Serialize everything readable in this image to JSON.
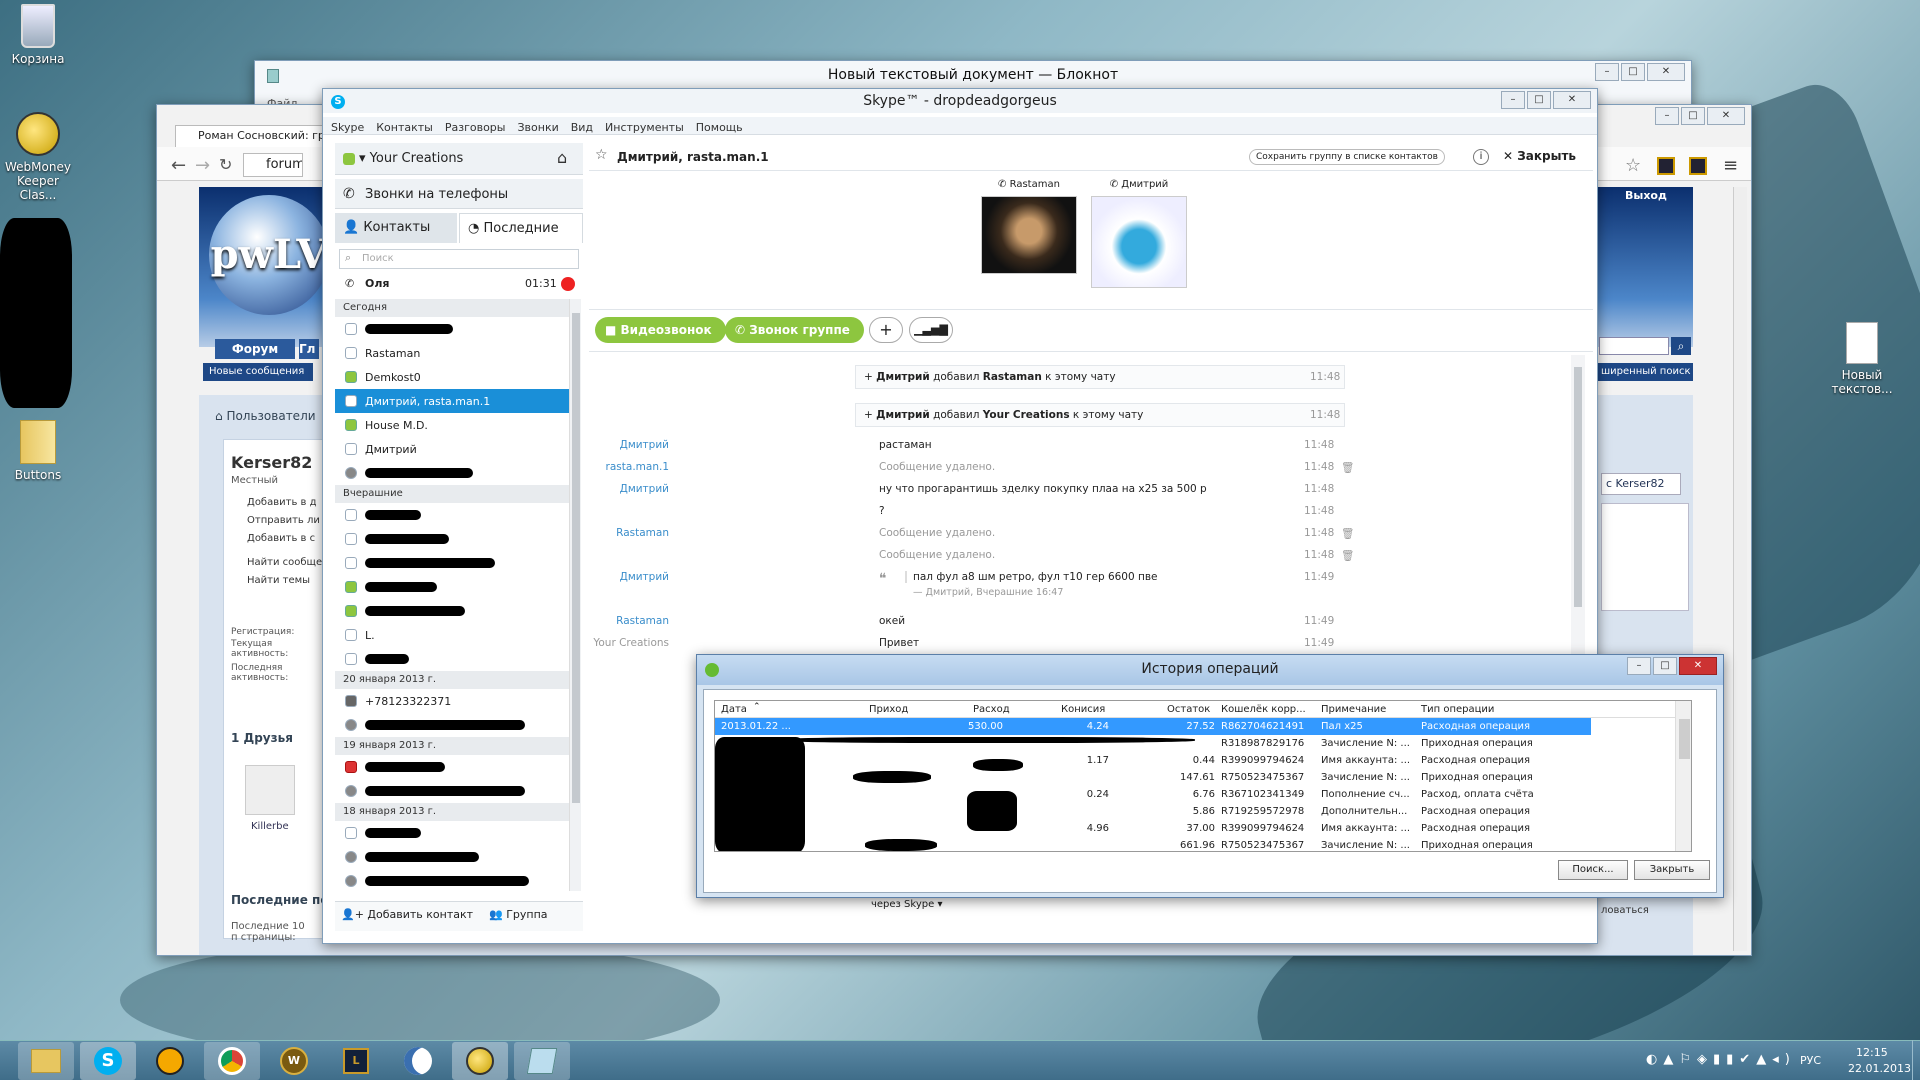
{
  "desktop": {
    "icons": [
      {
        "label": "Корзина"
      },
      {
        "label": "WebMoney Keeper Clas..."
      },
      {
        "label": "Buttons"
      },
      {
        "label": "Новый текстов..."
      }
    ]
  },
  "notepad": {
    "title": "Новый текстовый документ — Блокнот",
    "menu_file": "Файл"
  },
  "browser": {
    "tab_title": "Роман Сосновский: гр",
    "url": "forum",
    "logo": "pwLV",
    "nav_forum": "Форум",
    "nav_other": "Гл",
    "new_messages": "Новые сообщения",
    "exit": "Выход",
    "ext_search": "ширенный поиск",
    "breadcrumb": "Пользователи",
    "username": "Kerser82",
    "user_role": "Местный",
    "actions": [
      "Добавить в д",
      "Отправить ли",
      "Добавить в с",
      "Найти сообще",
      "Найти темы"
    ],
    "stats_labels": [
      "Регистрация:",
      "Текущая активность:",
      "Последняя активность:"
    ],
    "friends": "1 Друзья",
    "friend_name": "Killerbe",
    "recent_visits": "Последние по",
    "recent_sub": "Последние 10 п страницы:",
    "right_tab": "с Kerser82",
    "right_link": "ловаться"
  },
  "skype": {
    "title": "Skype™ - dropdeadgorgeus",
    "menu": [
      "Skype",
      "Контакты",
      "Разговоры",
      "Звонки",
      "Вид",
      "Инструменты",
      "Помощь"
    ],
    "profile": "Your Creations",
    "phone_calls": "Звонки на телефоны",
    "tab_contacts": "Контакты",
    "tab_recent": "Последние",
    "search_placeholder": "Поиск",
    "active_call": {
      "name": "Оля",
      "time": "01:31"
    },
    "sections": {
      "today": "Сегодня",
      "yesterday": "Вчерашние",
      "jan20": "20 января 2013 г.",
      "jan19": "19 января 2013 г.",
      "jan18": "18 января 2013 г."
    },
    "contacts_today": [
      "Rastaman",
      "Demkost0",
      "Дмитрий, rasta.man.1",
      "House M.D.",
      "Дмитрий"
    ],
    "contact_L": "L.",
    "contact_phone": "+78123322371",
    "add_contact": "Добавить контакт",
    "group": "Группа",
    "chat_title": "Дмитрий, rasta.man.1",
    "save_group": "Сохранить группу в списке контактов",
    "close": "Закрыть",
    "participants": [
      "Rastaman",
      "Дмитрий"
    ],
    "video_call": "Видеозвонок",
    "group_call": "Звонок группе",
    "via": "через Skype",
    "system_msgs": [
      {
        "actor": "Дмитрий",
        "mid": "добавил",
        "target": "Rastaman",
        "rest": "к этому чату",
        "time": "11:48"
      },
      {
        "actor": "Дмитрий",
        "mid": "добавил",
        "target": "Your Creations",
        "rest": "к этому чату",
        "time": "11:48"
      }
    ],
    "messages": [
      {
        "who": "Дмитрий",
        "text": "растаман",
        "time": "11:48"
      },
      {
        "who": "rasta.man.1",
        "text": "Сообщение удалено.",
        "time": "11:48"
      },
      {
        "who": "Дмитрий",
        "text": "ну что прогарантишь зделку покупку плаа на х25 за 500 р",
        "time": "11:48"
      },
      {
        "who": "",
        "text": "?",
        "time": "11:48"
      },
      {
        "who": "Rastaman",
        "text": "Сообщение удалено.",
        "time": "11:48"
      },
      {
        "who": "",
        "text": "Сообщение удалено.",
        "time": "11:48"
      },
      {
        "who": "Дмитрий",
        "text": "пал фул а8 шм ретро, фул т10 гер 6600 пве",
        "time": "11:49"
      },
      {
        "who": "Rastaman",
        "text": "окей",
        "time": "11:49"
      },
      {
        "who": "Your Creations",
        "text": "Привет",
        "time": "11:49"
      }
    ],
    "quote_meta": "— Дмитрий, Вчерашние 16:47"
  },
  "history": {
    "title": "История операций",
    "columns": [
      "Дата",
      "Приход",
      "Расход",
      "Конисия",
      "Остаток",
      "Кошелёк корр...",
      "Примечание",
      "Тип операции"
    ],
    "rows": [
      {
        "date": "2013.01.22 ...",
        "in": "",
        "out": "530.00",
        "fee": "4.24",
        "bal": "27.52",
        "wallet": "R862704621491",
        "note": "Пал х25",
        "type": "Расходная операция"
      },
      {
        "date": "",
        "in": "",
        "out": "",
        "fee": "",
        "bal": "",
        "wallet": "R318987829176",
        "note": "Зачисление N: ...",
        "type": "Приходная операция"
      },
      {
        "date": "",
        "in": "",
        "out": "",
        "fee": "1.17",
        "bal": "0.44",
        "wallet": "R399099794624",
        "note": "Имя аккаунта: ...",
        "type": "Расходная операция"
      },
      {
        "date": "",
        "in": "",
        "out": "",
        "fee": "",
        "bal": "147.61",
        "wallet": "R750523475367",
        "note": "Зачисление N: ...",
        "type": "Приходная операция"
      },
      {
        "date": "",
        "in": "",
        "out": "",
        "fee": "0.24",
        "bal": "6.76",
        "wallet": "R367102341349",
        "note": "Пополнение сч...",
        "type": "Расход, оплата счёта"
      },
      {
        "date": "",
        "in": "",
        "out": "",
        "fee": "",
        "bal": "5.86",
        "wallet": "R719259572978",
        "note": "Дополнительн...",
        "type": "Расходная операция"
      },
      {
        "date": "",
        "in": "",
        "out": "",
        "fee": "4.96",
        "bal": "37.00",
        "wallet": "R399099794624",
        "note": "Имя аккаунта: ...",
        "type": "Расходная операция"
      },
      {
        "date": "",
        "in": "",
        "out": "",
        "fee": "",
        "bal": "661.96",
        "wallet": "R750523475367",
        "note": "Зачисление N: ...",
        "type": "Приходная операция"
      }
    ],
    "search_btn": "Поиск...",
    "close_btn": "Закрыть"
  },
  "taskbar": {
    "lang": "РУС",
    "time": "12:15",
    "date": "22.01.2013"
  }
}
